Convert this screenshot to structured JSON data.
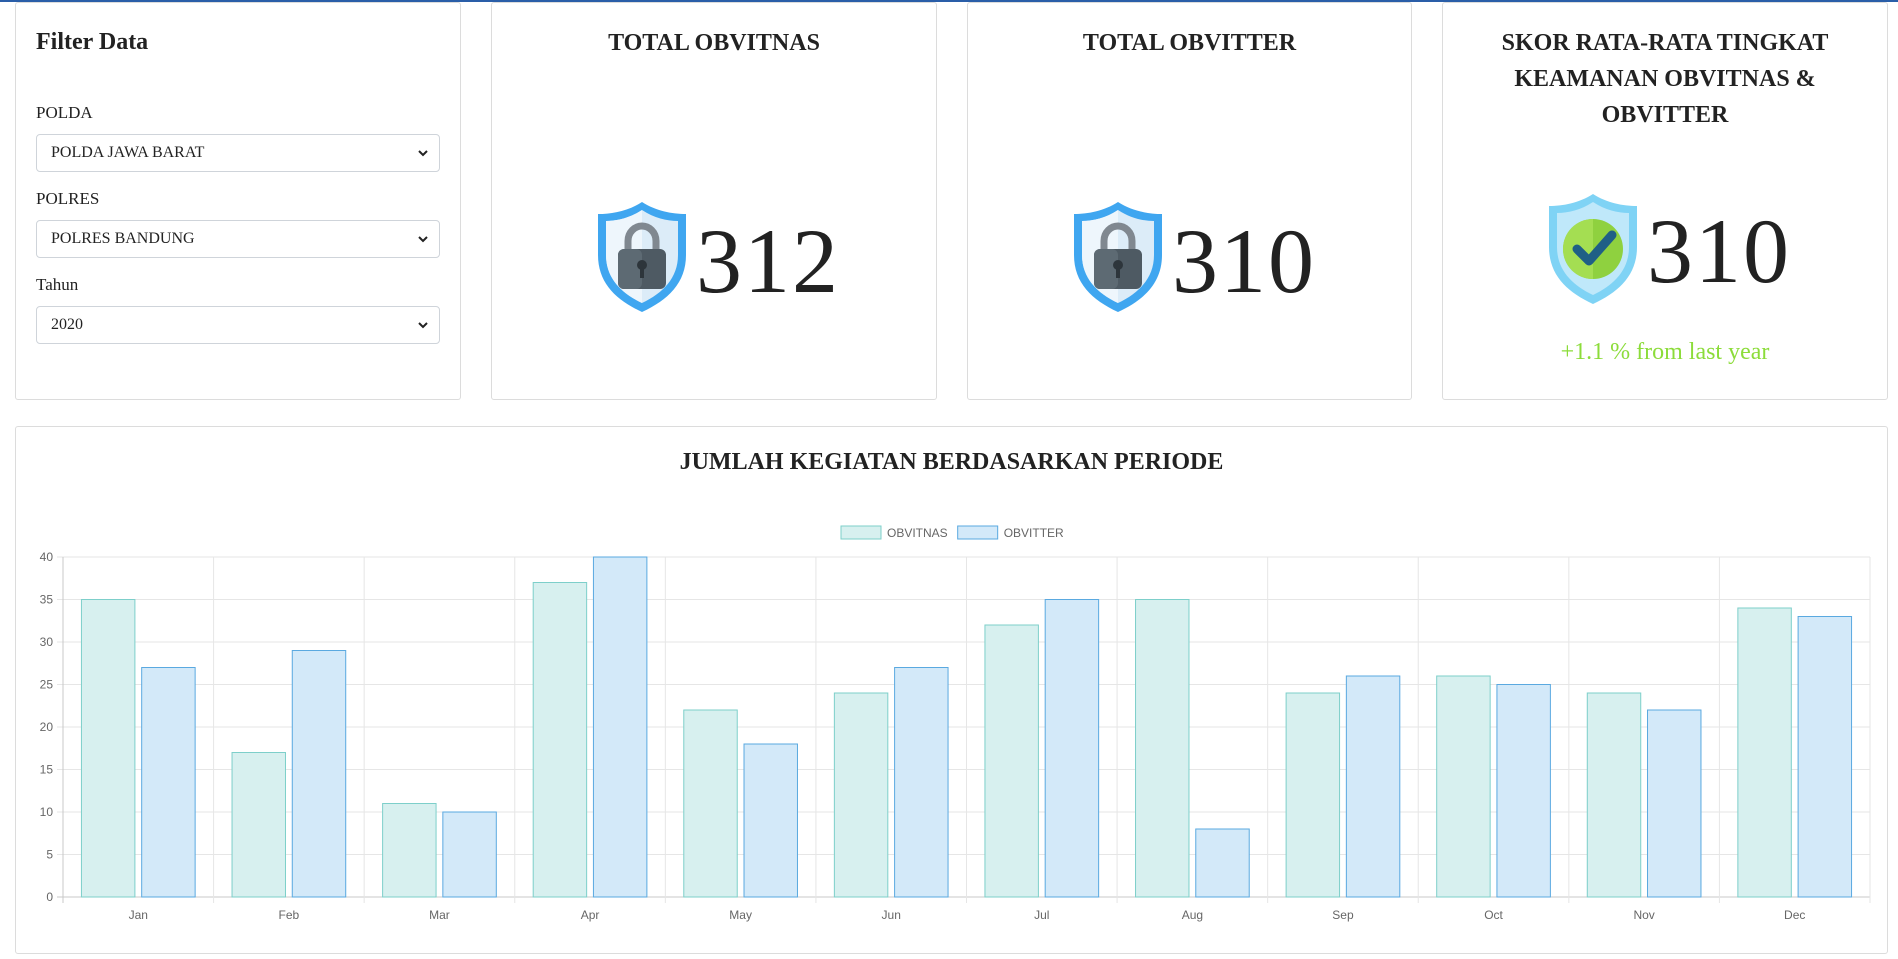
{
  "filter": {
    "title": "Filter Data",
    "fields": [
      {
        "label": "POLDA",
        "value": "POLDA JAWA BARAT"
      },
      {
        "label": "POLRES",
        "value": "POLRES BANDUNG"
      },
      {
        "label": "Tahun",
        "value": "2020"
      }
    ]
  },
  "stats": {
    "obvitnas": {
      "title": "TOTAL OBVITNAS",
      "value": "312",
      "icon": "lock-shield-icon"
    },
    "obvitter": {
      "title": "TOTAL OBVITTER",
      "value": "310",
      "icon": "lock-shield-icon"
    },
    "score": {
      "title": "SKOR RATA-RATA TINGKAT KEAMANAN OBVITNAS & OBVITTER",
      "value": "310",
      "trend": "+1.1 % from last year",
      "trend_color": "#8cdc3a",
      "icon": "check-shield-icon"
    }
  },
  "chart_data": {
    "type": "bar",
    "title": "JUMLAH KEGIATAN BERDASARKAN PERIODE",
    "categories": [
      "Jan",
      "Feb",
      "Mar",
      "Apr",
      "May",
      "Jun",
      "Jul",
      "Aug",
      "Sep",
      "Oct",
      "Nov",
      "Dec"
    ],
    "series": [
      {
        "name": "OBVITNAS",
        "values": [
          35,
          17,
          11,
          37,
          22,
          24,
          32,
          35,
          24,
          26,
          24,
          34
        ],
        "fill": "#d7f0ef",
        "stroke": "#7dcfca"
      },
      {
        "name": "OBVITTER",
        "values": [
          27,
          29,
          10,
          40,
          18,
          27,
          35,
          8,
          26,
          25,
          22,
          33
        ],
        "fill": "#d3e9f9",
        "stroke": "#5aa9e0"
      }
    ],
    "ylim": [
      0,
      40
    ],
    "yticks": [
      0,
      5,
      10,
      15,
      20,
      25,
      30,
      35,
      40
    ],
    "legend": "top-center",
    "grid": true
  }
}
